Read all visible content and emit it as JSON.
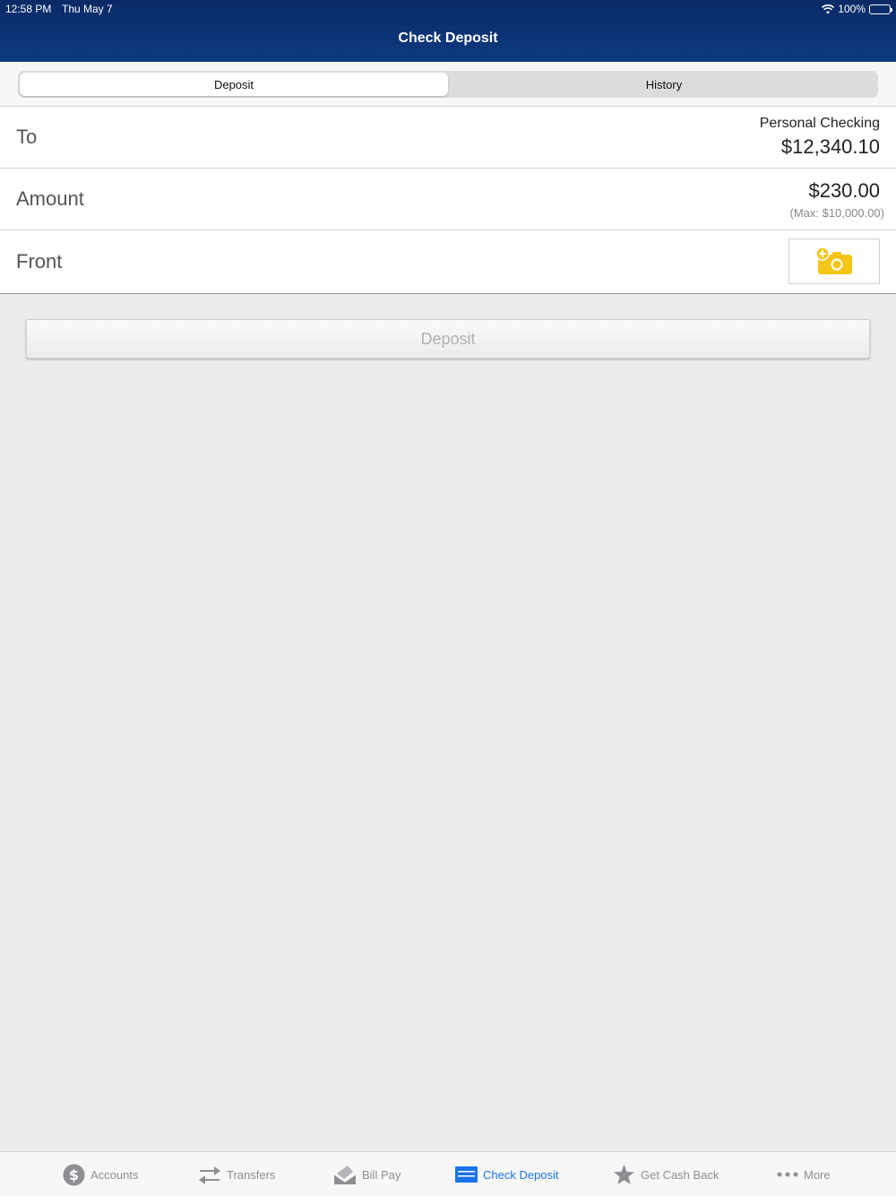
{
  "status_bar": {
    "time": "12:58 PM",
    "date": "Thu May 7",
    "battery": "100%"
  },
  "nav": {
    "title": "Check Deposit"
  },
  "segments": [
    {
      "label": "Deposit",
      "active": true
    },
    {
      "label": "History",
      "active": false
    }
  ],
  "form": {
    "to": {
      "label": "To",
      "account_name": "Personal Checking",
      "balance": "$12,340.10"
    },
    "amount": {
      "label": "Amount",
      "value": "$230.00",
      "max_note": "(Max: $10,000.00)"
    },
    "front": {
      "label": "Front",
      "icon": "add-camera-icon"
    }
  },
  "deposit_button": {
    "label": "Deposit"
  },
  "tabs": [
    {
      "label": "Accounts",
      "icon": "dollar-circle-icon"
    },
    {
      "label": "Transfers",
      "icon": "transfer-arrows-icon"
    },
    {
      "label": "Bill Pay",
      "icon": "bill-pay-icon"
    },
    {
      "label": "Check Deposit",
      "icon": "check-icon",
      "active": true
    },
    {
      "label": "Get Cash Back",
      "icon": "star-icon"
    },
    {
      "label": "More",
      "icon": "more-dots-icon"
    }
  ],
  "colors": {
    "header": "#0d3a80",
    "accent": "#1a73e8",
    "camera": "#f5c518"
  }
}
